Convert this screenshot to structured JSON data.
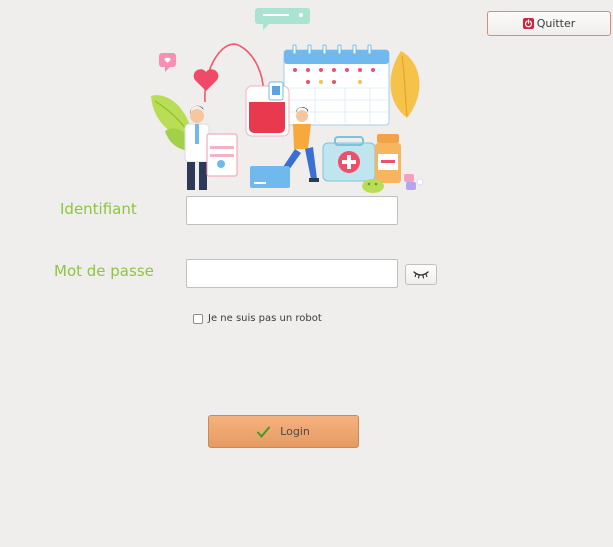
{
  "header": {
    "quit_label": "Quitter",
    "quit_icon": "power-icon"
  },
  "illustration": {
    "icon": "medical-illustration"
  },
  "form": {
    "username_label": "Identifiant",
    "username_value": "",
    "password_label": "Mot de passe",
    "password_value": "",
    "toggle_password_icon": "eye-closed-icon",
    "robot_checkbox_label": "Je ne suis pas un robot",
    "robot_checked": false,
    "login_label": "Login",
    "login_icon": "checkmark-icon"
  },
  "colors": {
    "label_green": "#8cc63f",
    "login_orange": "#eaa26b",
    "quit_red": "#c9283c"
  }
}
